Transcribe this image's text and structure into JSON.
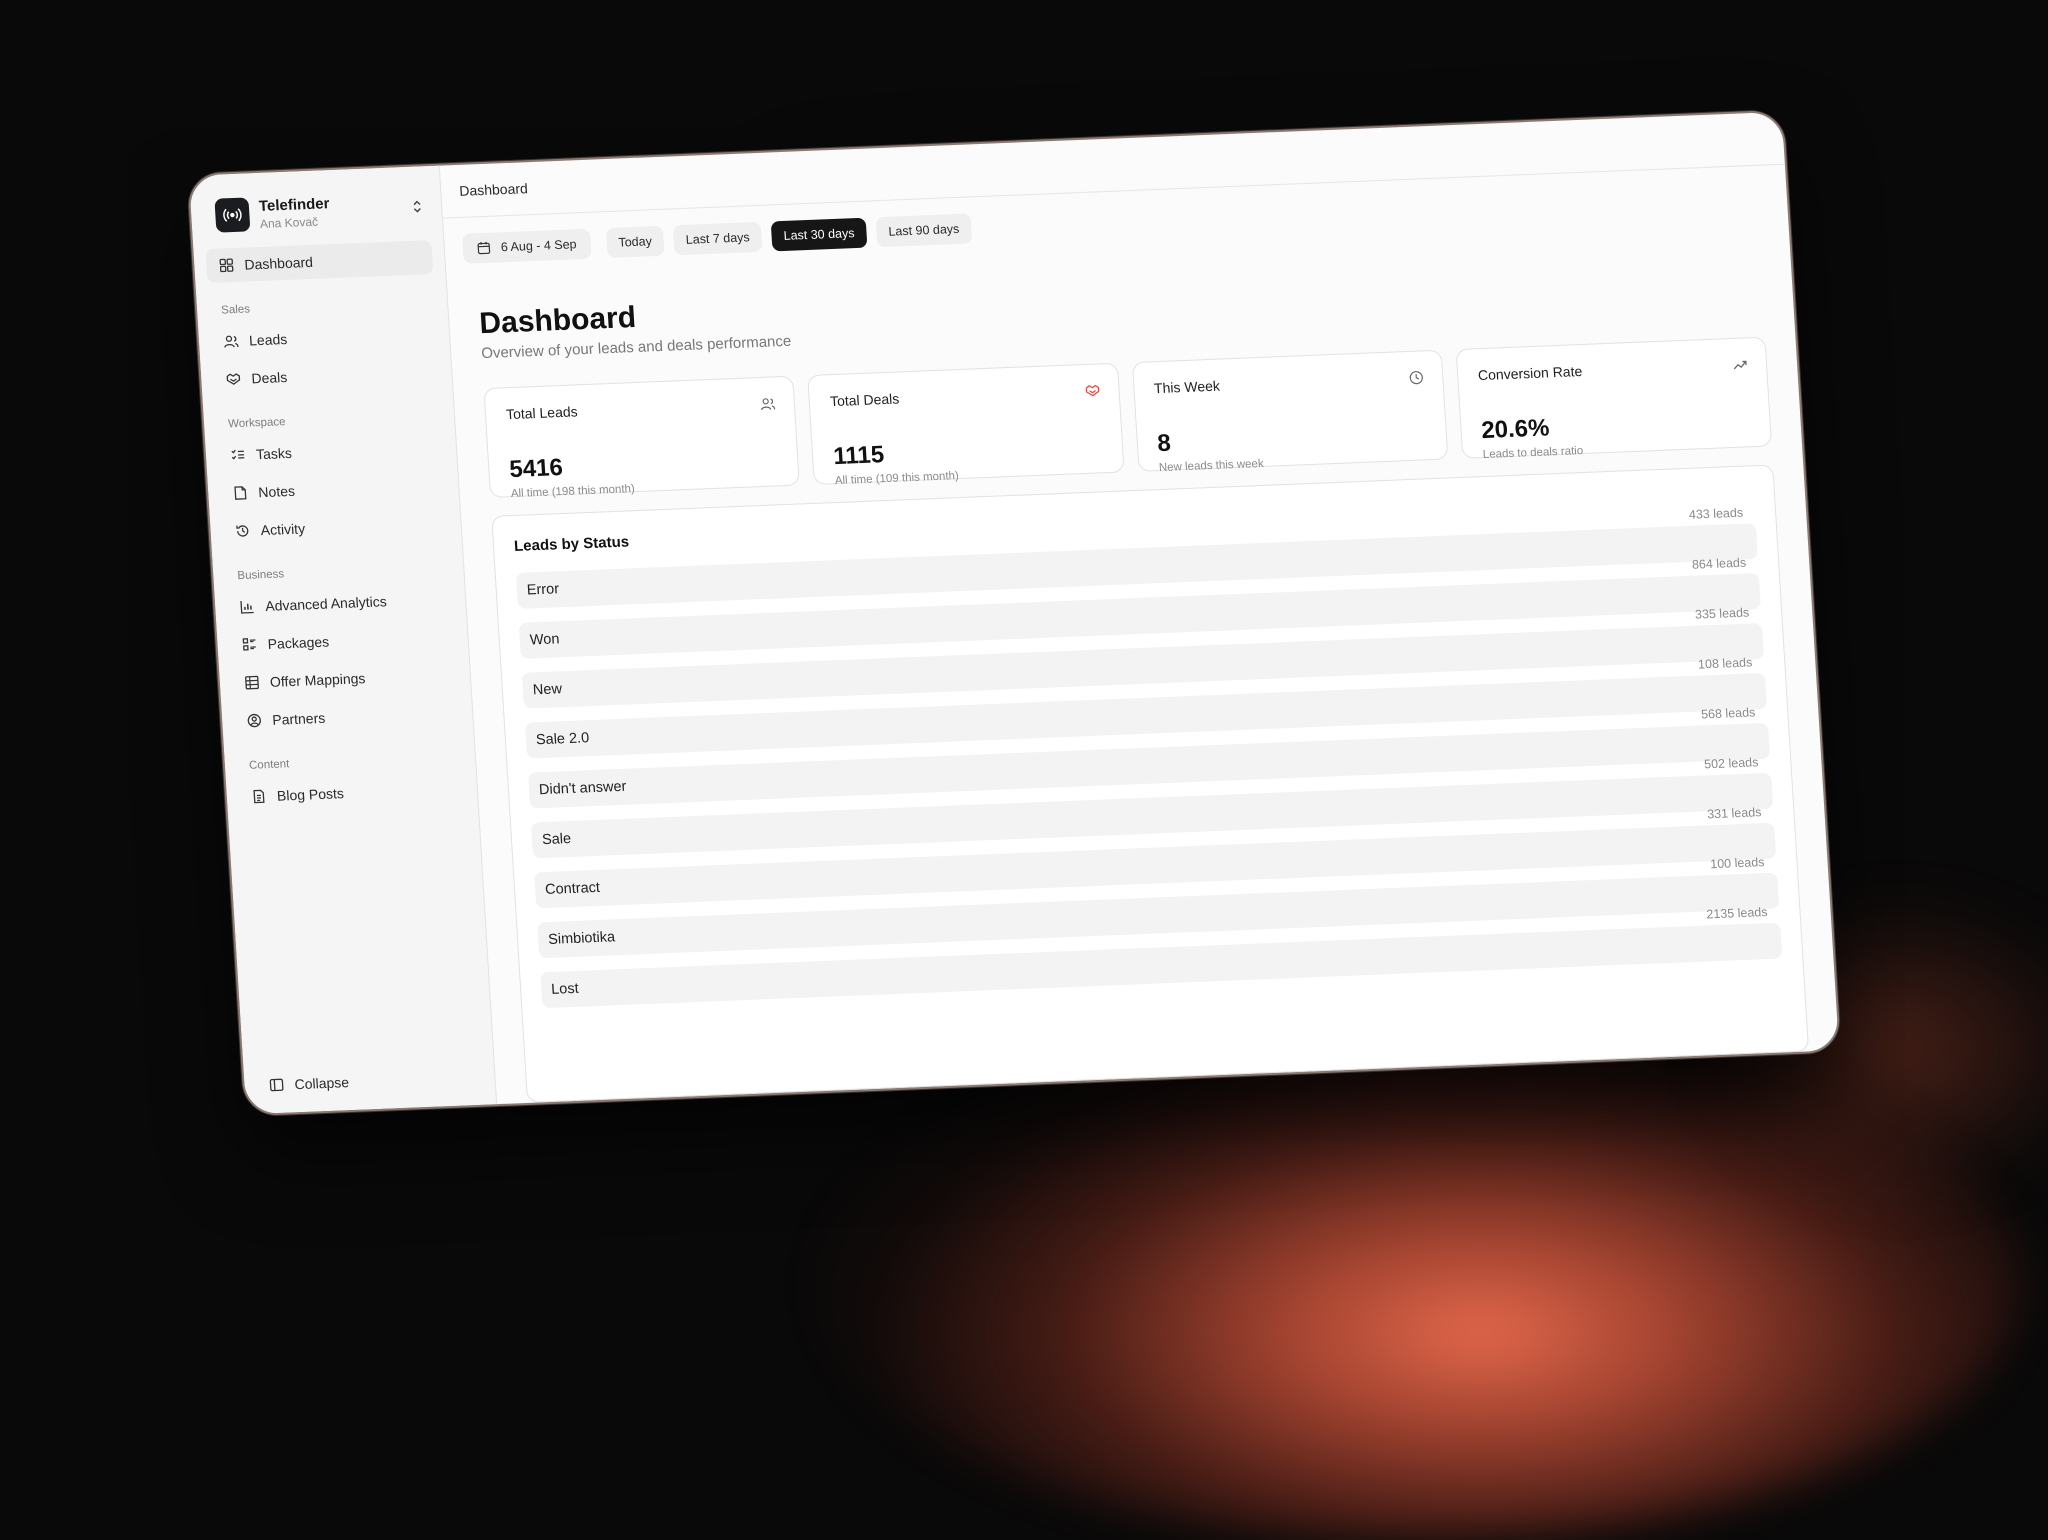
{
  "brand": {
    "name": "Telefinder",
    "user": "Ana Kovač"
  },
  "sidebar": {
    "dashboard": "Dashboard",
    "groups": [
      {
        "label": "Sales",
        "items": [
          {
            "label": "Leads",
            "icon": "users-icon"
          },
          {
            "label": "Deals",
            "icon": "handshake-icon"
          }
        ]
      },
      {
        "label": "Workspace",
        "items": [
          {
            "label": "Tasks",
            "icon": "checklist-icon"
          },
          {
            "label": "Notes",
            "icon": "note-icon"
          },
          {
            "label": "Activity",
            "icon": "history-icon"
          }
        ]
      },
      {
        "label": "Business",
        "items": [
          {
            "label": "Advanced Analytics",
            "icon": "bar-chart-icon"
          },
          {
            "label": "Packages",
            "icon": "grid-list-icon"
          },
          {
            "label": "Offer Mappings",
            "icon": "table-icon"
          },
          {
            "label": "Partners",
            "icon": "user-circle-icon"
          }
        ]
      },
      {
        "label": "Content",
        "items": [
          {
            "label": "Blog Posts",
            "icon": "document-icon"
          }
        ]
      }
    ],
    "collapse": "Collapse"
  },
  "topbar": {
    "breadcrumb": "Dashboard"
  },
  "filters": {
    "date_range": "6 Aug - 4 Sep",
    "ranges": [
      "Today",
      "Last 7 days",
      "Last 30 days",
      "Last 90 days"
    ],
    "active_range": "Last 30 days"
  },
  "page": {
    "title": "Dashboard",
    "subtitle": "Overview of your leads and deals performance"
  },
  "stats": [
    {
      "label": "Total Leads",
      "value": "5416",
      "note": "All time (198 this month)",
      "icon": "users-icon"
    },
    {
      "label": "Total Deals",
      "value": "1115",
      "note": "All time (109 this month)",
      "icon": "handshake-icon"
    },
    {
      "label": "This Week",
      "value": "8",
      "note": "New leads this week",
      "icon": "clock-icon"
    },
    {
      "label": "Conversion Rate",
      "value": "20.6%",
      "note": "Leads to deals ratio",
      "icon": "trend-up-icon"
    }
  ],
  "leads_by_status": {
    "title": "Leads by Status",
    "rows": [
      {
        "status": "Error",
        "count": "433 leads"
      },
      {
        "status": "Won",
        "count": "864 leads"
      },
      {
        "status": "New",
        "count": "335 leads"
      },
      {
        "status": "Sale 2.0",
        "count": "108 leads"
      },
      {
        "status": "Didn't answer",
        "count": "568 leads"
      },
      {
        "status": "Sale",
        "count": "502 leads"
      },
      {
        "status": "Contract",
        "count": "331 leads"
      },
      {
        "status": "Simbiotika",
        "count": "100 leads"
      },
      {
        "status": "Lost",
        "count": "2135 leads"
      }
    ]
  },
  "colors": {
    "accent_active": "#161616",
    "deal_icon": "#e0534a"
  }
}
